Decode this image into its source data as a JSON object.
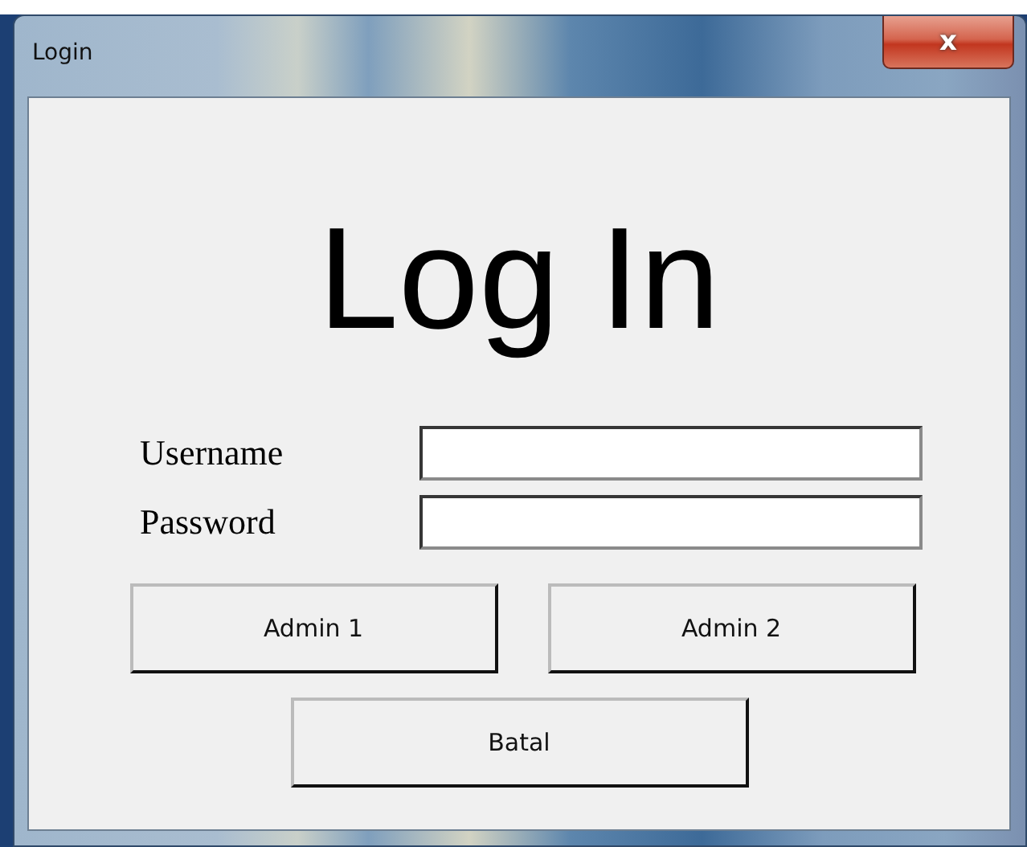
{
  "window": {
    "title": "Login",
    "close": "x"
  },
  "heading": "Log In",
  "fields": [
    {
      "label": "Username"
    },
    {
      "label": "Password"
    }
  ],
  "buttons": [
    {
      "label": "Admin 1"
    },
    {
      "label": "Admin 2"
    },
    {
      "label": "Batal"
    }
  ]
}
